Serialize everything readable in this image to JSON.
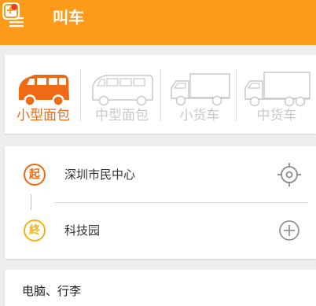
{
  "colors": {
    "header": "#fd9a1a",
    "accent": "#ee6a14",
    "end_badge": "#f2b21a",
    "inactive": "#c9c9c9"
  },
  "header": {
    "title": "叫车",
    "menu_icon": "menu-with-notification-icon"
  },
  "vehicles": [
    {
      "label": "小型面包",
      "icon": "small-van-icon",
      "selected": true
    },
    {
      "label": "中型面包",
      "icon": "medium-van-icon",
      "selected": false
    },
    {
      "label": "小货车",
      "icon": "small-truck-icon",
      "selected": false
    },
    {
      "label": "中货车",
      "icon": "medium-truck-icon",
      "selected": false
    }
  ],
  "route": {
    "start": {
      "badge": "起",
      "address": "深圳市民中心",
      "action_icon": "locate-icon"
    },
    "end": {
      "badge": "終",
      "address": "科技园",
      "action_icon": "add-stop-icon"
    }
  },
  "note": {
    "value": "电脑、行李"
  }
}
